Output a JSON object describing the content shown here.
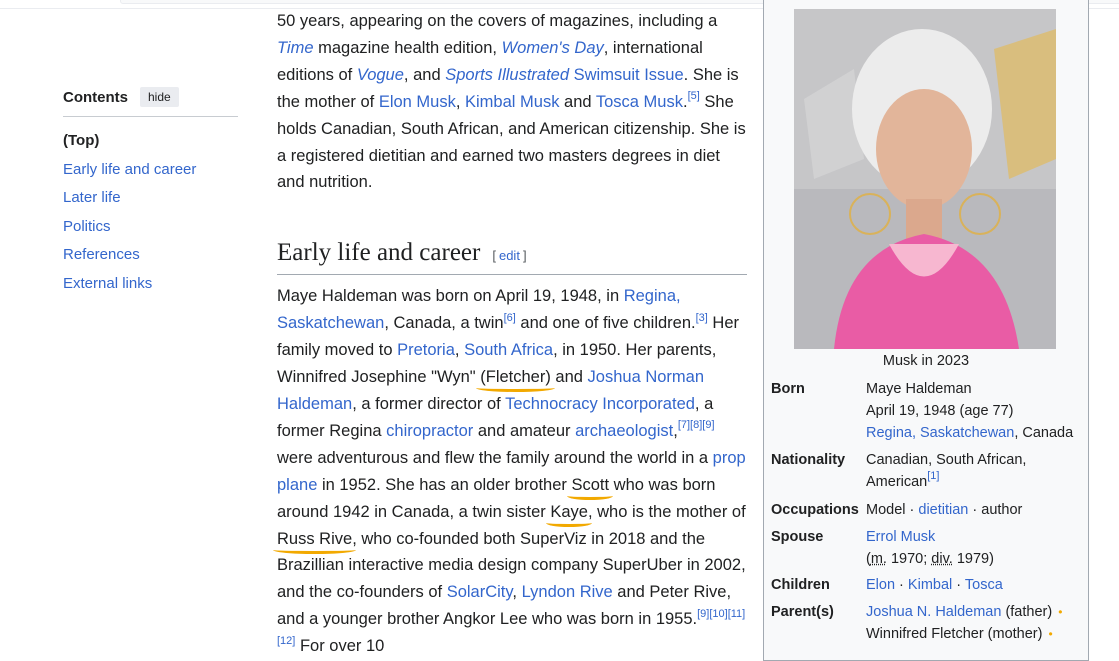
{
  "toc": {
    "title": "Contents",
    "hide_label": "hide",
    "items": [
      "(Top)",
      "Early life and career",
      "Later life",
      "Politics",
      "References",
      "External links"
    ]
  },
  "intro": {
    "t1": "50 years, appearing on the covers of magazines, including a ",
    "l_time": "Time",
    "t2": " magazine health edition, ",
    "l_womens": "Women's Day",
    "t3": ", international editions of ",
    "l_vogue": "Vogue",
    "t4": ", and ",
    "l_si": "Sports Illustrated",
    "t5": " ",
    "l_swim": "Swimsuit Issue",
    "t6": ". She is the mother of ",
    "l_elon": "Elon Musk",
    "t7": ", ",
    "l_kimbal": "Kimbal Musk",
    "t8": " and ",
    "l_tosca": "Tosca Musk",
    "t9": ".",
    "r5": "[5]",
    "t10": " She holds Canadian, South African, and American citizenship. She is a registered dietitian and earned two masters degrees in diet and nutrition."
  },
  "section": {
    "title": "Early life and career",
    "edit_open": "[",
    "edit_label": "edit",
    "edit_close": "]"
  },
  "para": {
    "s1": "Maye Haldeman was born on April 19, 1948, in ",
    "l_regina": "Regina, Saskatchewan",
    "s2": ", Canada, a twin",
    "r6": "[6]",
    "s3": " and one of five children.",
    "r3": "[3]",
    "s4": " Her family moved to ",
    "l_pretoria": "Pretoria",
    "s5": ", ",
    "l_sa": "South Africa",
    "s6": ", in 1950. Her parents, Winnifred Josephine \"Wyn\" ",
    "u_fletcher": "(Fletcher)",
    "s7": " and ",
    "l_joshua": "Joshua Norman Haldeman",
    "s8": ", a former director of ",
    "l_techno": "Technocracy Incorporated",
    "s9": ", a former Regina ",
    "l_chiro": "chiropractor",
    "s10": " and amateur ",
    "l_arch": "archaeologist",
    "s11": ",",
    "r789": "[7][8][9]",
    "s12": " were adventurous and flew the family around the world in a ",
    "l_prop": "prop plane",
    "s13": " in 1952. She has an older brother ",
    "u_scott": "Scott",
    "s14": " who was born around 1942 in Canada, a twin sister ",
    "u_kaye": "Kaye",
    "s15": ", who is the mother of ",
    "u_russ": "Russ Rive",
    "s16": ", who co-founded both SuperViz in 2018 and the Brazillian interactive media design company SuperUber in 2002, and the co-founders of ",
    "l_solar": "SolarCity",
    "s17": ", ",
    "l_lyndon": "Lyndon Rive",
    "s18": " and Peter Rive, and a younger brother Angkor Lee who was born in 1955.",
    "r9_12": "[9][10][11][12]",
    "s19": " For over 10"
  },
  "infobox": {
    "caption": "Musk in 2023",
    "born_label": "Born",
    "born_name": "Maye Haldeman",
    "born_date": "April 19, 1948 (age 77)",
    "born_place_link": "Regina, Saskatchewan",
    "born_place_rest": ", Canada",
    "nationality_label": "Nationality",
    "nationality_value": "Canadian, South African, American",
    "nationality_ref": "[1]",
    "occupations_label": "Occupations",
    "occ1": "Model",
    "occ2": "dietitian",
    "occ3": "author",
    "sep": " · ",
    "spouse_label": "Spouse",
    "spouse_link": "Errol Musk",
    "spouse_detail_a": "(",
    "spouse_m": "m.",
    "spouse_detail_b": " 1970; ",
    "spouse_div": "div.",
    "spouse_detail_c": " 1979)",
    "children_label": "Children",
    "child1": "Elon",
    "child2": "Kimbal",
    "child3": "Tosca",
    "parents_label": "Parent(s)",
    "parent1_link": "Joshua N. Haldeman",
    "parent1_rest": " (father)",
    "parent2": "Winnifred Fletcher (mother)",
    "dot": "•"
  },
  "colors": {
    "link": "#3366cc",
    "underline_annotation": "#f2a900",
    "infobox_bg": "#f8f9fa"
  }
}
